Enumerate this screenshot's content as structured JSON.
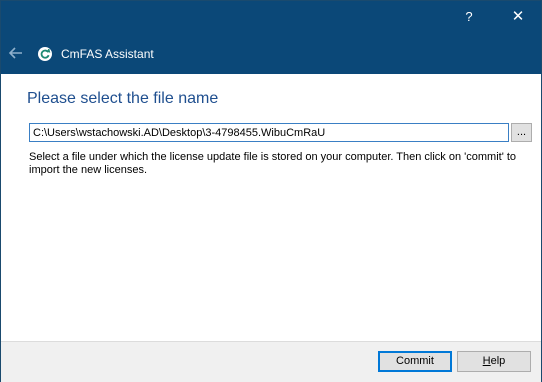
{
  "window": {
    "help_glyph": "?",
    "close_glyph": "✕",
    "app_title": "CmFAS Assistant",
    "back_icon": "back-arrow-icon",
    "app_icon": "cmfas-refresh-icon"
  },
  "main": {
    "heading": "Please select the file name",
    "file_path": "C:\\Users\\wstachowski.AD\\Desktop\\3-4798455.WibuCmRaU",
    "browse_label": "...",
    "description": "Select a file under which the license update file is stored on your computer. Then click on 'commit' to import the new licenses."
  },
  "footer": {
    "commit_label": "Commit",
    "help_label_underlined": "H",
    "help_label_rest": "elp"
  },
  "colors": {
    "titlebar": "#0b4878",
    "heading": "#1f4f8f",
    "input_border": "#3a7fc4",
    "default_button_border": "#0078d7"
  }
}
